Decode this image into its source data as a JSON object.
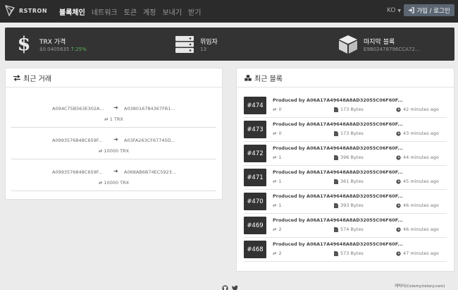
{
  "brand": {
    "name": "RSTRON"
  },
  "nav": {
    "items": [
      {
        "label": "블록체인",
        "active": true
      },
      {
        "label": "네트워크",
        "active": false
      },
      {
        "label": "토큰",
        "active": false
      },
      {
        "label": "계정",
        "active": false
      },
      {
        "label": "보내기",
        "active": false
      },
      {
        "label": "받기",
        "active": false
      }
    ],
    "lang": "KO",
    "login_label": "가입 / 로그인"
  },
  "stats": {
    "price": {
      "title": "TRX 가격",
      "value": "$0.0405635",
      "change": "7.25%"
    },
    "witnesses": {
      "title": "위임자",
      "value": "13"
    },
    "last_block": {
      "title": "마지막 블록",
      "value": "E9B02478796CCA72..."
    }
  },
  "transfers": {
    "title": "최근 거래",
    "rows": [
      {
        "from": "A094C75B563E302A...",
        "to": "A038016784367FB1...",
        "amount": "1 TRX"
      },
      {
        "from": "A0993576848C659F...",
        "to": "A03FA263CF67745D...",
        "amount": "10000 TRX"
      },
      {
        "from": "A0993576848C659F...",
        "to": "A068AB6B74EC5923...",
        "amount": "10000 TRX"
      }
    ]
  },
  "blocks": {
    "title": "최근 블록",
    "rows": [
      {
        "number": "#474",
        "producer": "Produced by A06A17A49648A8AD32055C06F60F...",
        "tx": "0",
        "size": "173 Bytes",
        "age": "42 minutes ago"
      },
      {
        "number": "#473",
        "producer": "Produced by A06A17A49648A8AD32055C06F60F...",
        "tx": "0",
        "size": "173 Bytes",
        "age": "43 minutes ago"
      },
      {
        "number": "#472",
        "producer": "Produced by A06A17A49648A8AD32055C06F60F...",
        "tx": "1",
        "size": "396 Bytes",
        "age": "44 minutes ago"
      },
      {
        "number": "#471",
        "producer": "Produced by A06A17A49648A8AD32055C06F60F...",
        "tx": "1",
        "size": "361 Bytes",
        "age": "45 minutes ago"
      },
      {
        "number": "#470",
        "producer": "Produced by A06A17A49648A8AD32055C06F60F...",
        "tx": "1",
        "size": "393 Bytes",
        "age": "46 minutes ago"
      },
      {
        "number": "#469",
        "producer": "Produced by A06A17A49648A8AD32055C06F60F...",
        "tx": "2",
        "size": "574 Bytes",
        "age": "46 minutes ago"
      },
      {
        "number": "#468",
        "producer": "Produced by A06A17A49648A8AD32055C06F60F...",
        "tx": "2",
        "size": "573 Bytes",
        "age": "47 minutes ago"
      }
    ]
  },
  "footer": {
    "icons": [
      "github-icon",
      "twitter-icon"
    ],
    "credit": "캐릭터(Colomy.tistory.com)"
  },
  "colors": {
    "nav_bg": "#2b2b2b",
    "stats_bg": "#333333",
    "change_green": "#5cb85c",
    "page_bg": "#ebebeb"
  }
}
